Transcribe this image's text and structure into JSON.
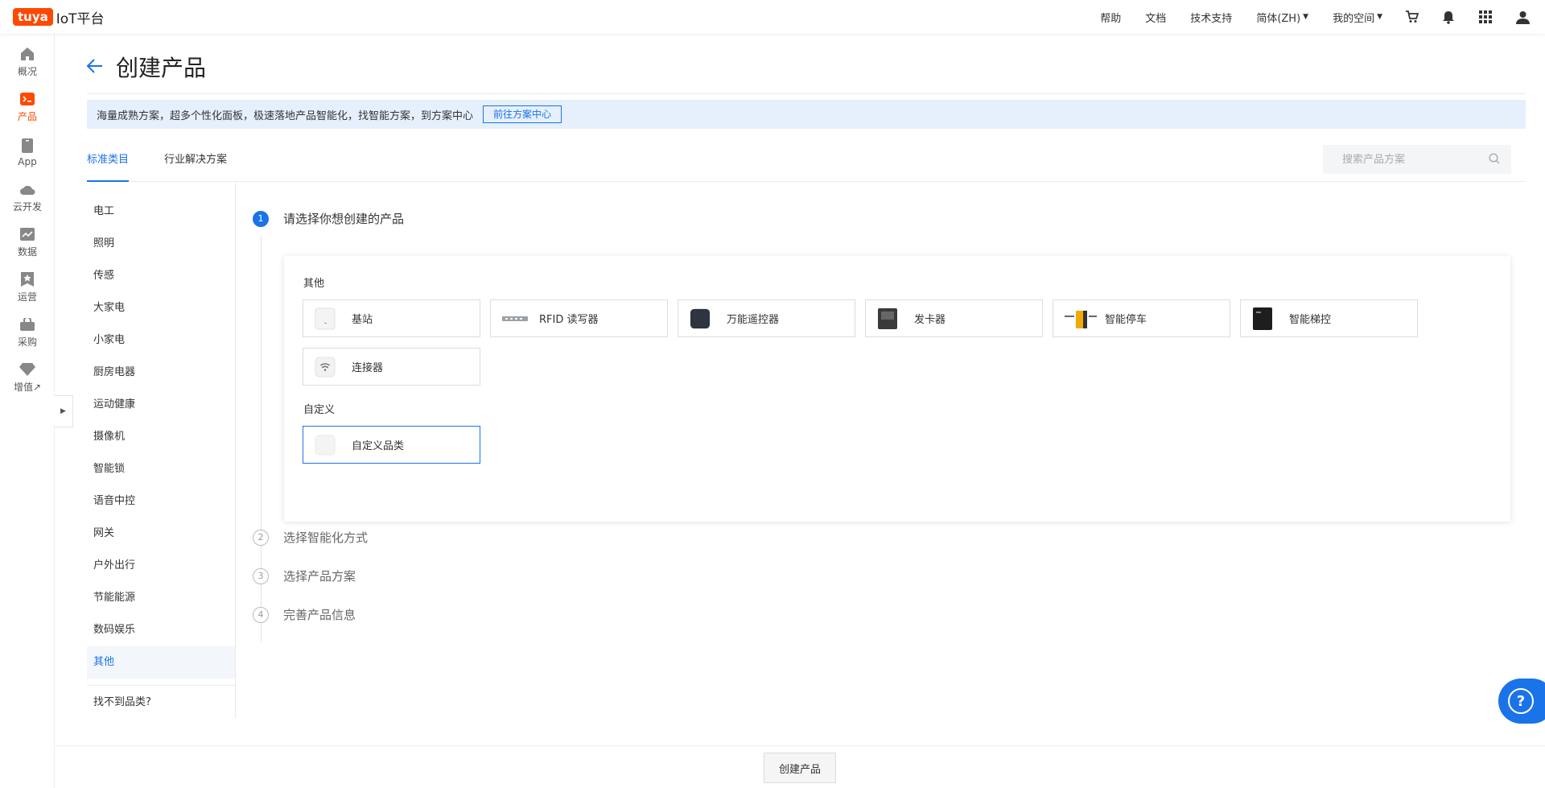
{
  "brand": {
    "badge": "tuya",
    "title": "IoT平台"
  },
  "topnav": {
    "links": [
      "帮助",
      "文档",
      "技术支持"
    ],
    "language": "简体(ZH)",
    "space": "我的空间",
    "icons": [
      "cart-icon",
      "bell-icon",
      "apps-grid-icon",
      "user-icon"
    ]
  },
  "sidebar": {
    "items": [
      {
        "label": "概况",
        "icon": "home-icon"
      },
      {
        "label": "产品",
        "icon": "product-terminal-icon",
        "active": true
      },
      {
        "label": "App",
        "icon": "app-phone-icon"
      },
      {
        "label": "云开发",
        "icon": "cloud-icon"
      },
      {
        "label": "数据",
        "icon": "chart-icon"
      },
      {
        "label": "运营",
        "icon": "star-flag-icon"
      },
      {
        "label": "采购",
        "icon": "bag-icon"
      },
      {
        "label": "增值↗",
        "icon": "diamond-icon"
      }
    ],
    "accent": "#ff4800"
  },
  "page": {
    "title": "创建产品",
    "banner_text": "海量成熟方案，超多个性化面板，极速落地产品智能化，找智能方案，到方案中心",
    "banner_button": "前往方案中心",
    "tabs": [
      "标准类目",
      "行业解决方案"
    ],
    "search_placeholder": "搜索产品方案"
  },
  "categories": {
    "items": [
      "电工",
      "照明",
      "传感",
      "大家电",
      "小家电",
      "厨房电器",
      "运动健康",
      "摄像机",
      "智能锁",
      "语音中控",
      "网关",
      "户外出行",
      "节能能源",
      "数码娱乐",
      "其他"
    ],
    "active": "其他",
    "missing": "找不到品类?"
  },
  "steps": [
    {
      "num": "1",
      "label": "请选择你想创建的产品",
      "active": true
    },
    {
      "num": "2",
      "label": "选择智能化方式"
    },
    {
      "num": "3",
      "label": "选择产品方案"
    },
    {
      "num": "4",
      "label": "完善产品信息"
    }
  ],
  "product_groups": [
    {
      "title": "其他",
      "items": [
        {
          "label": "基站",
          "icon": "base-station-icon"
        },
        {
          "label": "RFID 读写器",
          "icon": "rfid-reader-icon"
        },
        {
          "label": "万能遥控器",
          "icon": "remote-control-icon"
        },
        {
          "label": "发卡器",
          "icon": "card-issuer-icon"
        },
        {
          "label": "智能停车",
          "icon": "parking-gate-icon"
        },
        {
          "label": "智能梯控",
          "icon": "elevator-control-icon"
        },
        {
          "label": "连接器",
          "icon": "connector-wifi-icon"
        }
      ]
    },
    {
      "title": "自定义",
      "items": [
        {
          "label": "自定义品类",
          "icon": "custom-category-icon",
          "selected": true
        }
      ]
    }
  ],
  "footer": {
    "create_button": "创建产品"
  },
  "help": {
    "label": "?"
  },
  "colors": {
    "primary": "#1a73e8",
    "brand": "#ff4800",
    "banner_bg": "#e5f0fc"
  }
}
